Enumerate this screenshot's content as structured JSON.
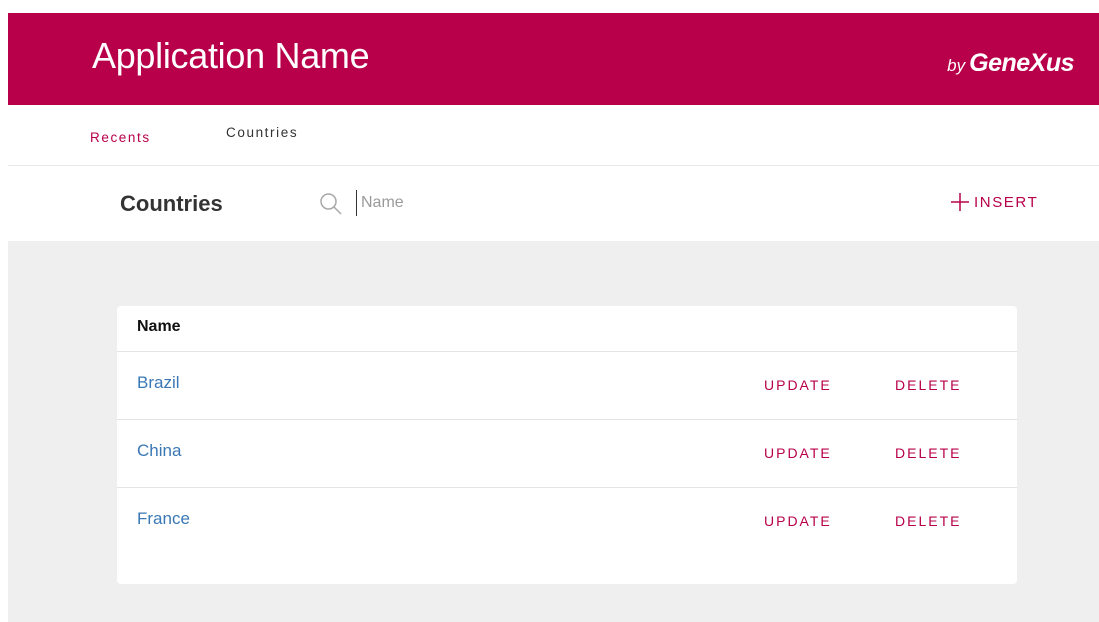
{
  "header": {
    "app_title": "Application Name",
    "brand_prefix": "by",
    "brand_name": "GeneXus",
    "background_color": "#b8004a"
  },
  "breadcrumb": {
    "items": [
      {
        "label": "Recents"
      },
      {
        "label": "Countries"
      }
    ]
  },
  "toolbar": {
    "page_title": "Countries",
    "search_icon": "search-icon",
    "search_placeholder": "Name",
    "insert_icon": "plus-icon",
    "insert_label": "INSERT"
  },
  "grid": {
    "columns": [
      "Name"
    ],
    "rows": [
      {
        "name": "Brazil",
        "update_label": "UPDATE",
        "delete_label": "DELETE"
      },
      {
        "name": "China",
        "update_label": "UPDATE",
        "delete_label": "DELETE"
      },
      {
        "name": "France",
        "update_label": "UPDATE",
        "delete_label": "DELETE"
      }
    ]
  },
  "colors": {
    "accent": "#b8004a",
    "link": "#3a78b5",
    "content_background": "#efefef"
  }
}
